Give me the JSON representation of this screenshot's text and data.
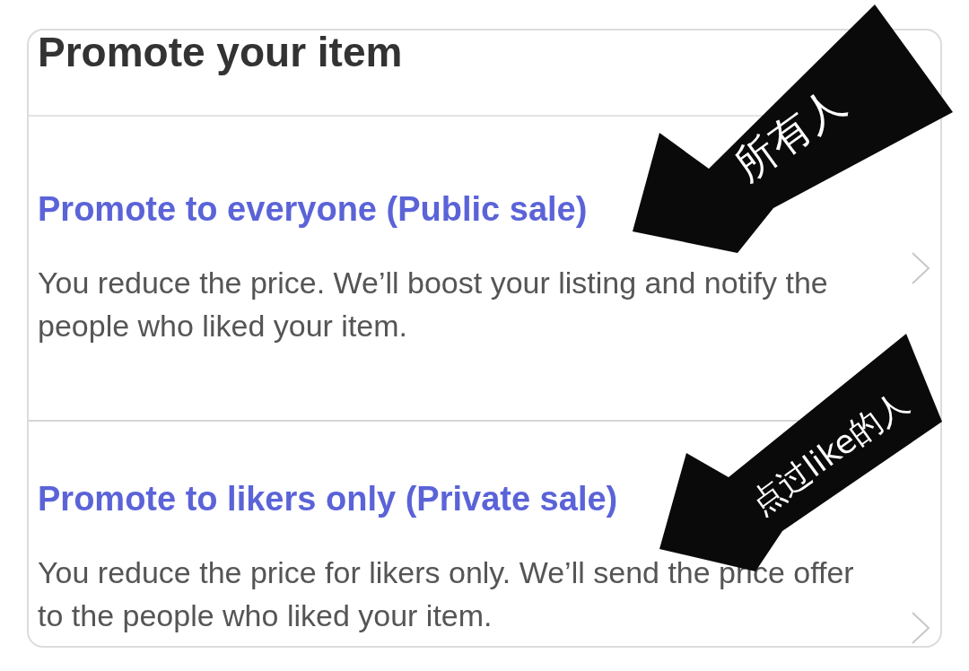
{
  "header": {
    "title": "Promote your item"
  },
  "options": [
    {
      "title": "Promote to everyone (Public sale)",
      "description": "You reduce the price. We’ll boost your listing and notify the people who liked your item."
    },
    {
      "title": "Promote to likers only (Private sale)",
      "description": "You reduce the price for likers only. We’ll send the price offer to the people who liked your item."
    }
  ],
  "annotations": [
    {
      "text": "所有人"
    },
    {
      "text": "点过like的人"
    }
  ]
}
